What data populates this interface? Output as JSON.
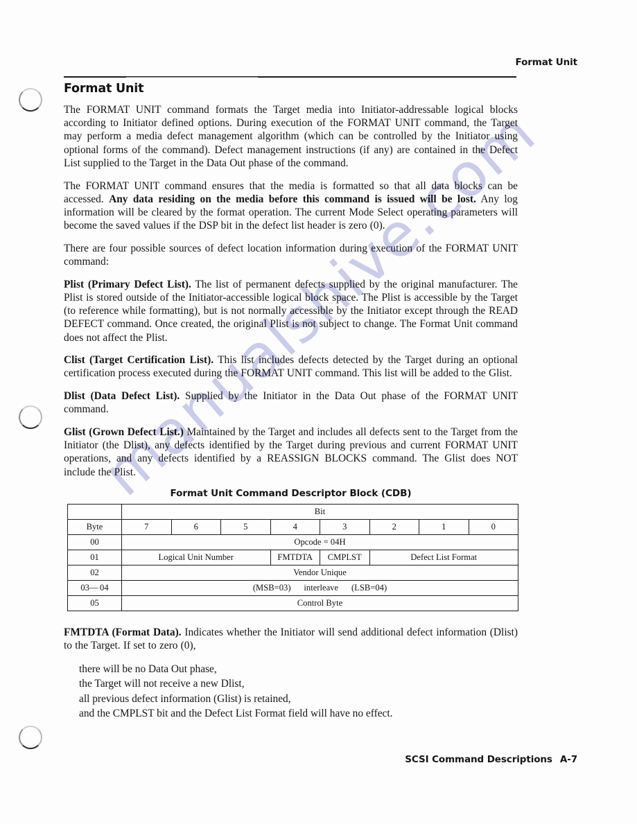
{
  "document": {
    "running_head": "Format Unit",
    "section_title": "Format Unit",
    "watermark": "manualshive.com",
    "watermark_color": "#c6c8ea",
    "footer": {
      "title": "SCSI Command Descriptions",
      "page": "A-7"
    },
    "ring_holes": 3
  },
  "paragraphs": {
    "p1": "The FORMAT UNIT command formats the Target media into Initiator-addressable logical blocks according to Initiator defined options. During execution of the FORMAT UNIT command, the Target may perform a media defect management algorithm (which can be controlled by the Initiator using optional forms of the command). Defect management instructions (if any) are contained in the Defect List supplied to the Target in the Data Out phase of the command.",
    "p2_a": "The FORMAT UNIT command ensures that the media is formatted so that all data blocks can be accessed. ",
    "p2_bold": "Any data residing on the media before this command is issued will be lost.",
    "p2_b": " Any log information will be cleared by the format operation. The current Mode Select operating parameters will become the saved values if the DSP bit in the defect list header is zero (0).",
    "p3": "There are four possible sources of defect location information during execution of the FORMAT UNIT command:",
    "plist_bold": "Plist (Primary Defect List).",
    "plist_text": " The list of permanent defects supplied by the original manufacturer. The Plist is stored outside of the Initiator-accessible logical block space. The Plist is accessible by the Target (to reference while formatting), but is not normally accessible by the Initiator except through the READ DEFECT command. Once created, the original Plist is not subject to change. The Format Unit command does not affect the Plist.",
    "clist_bold": "Clist (Target Certification List).",
    "clist_text": " This list includes defects detected by the Target during an optional certification process executed during the FORMAT UNIT command. This list will be added to the Glist.",
    "dlist_bold": "Dlist (Data Defect List).",
    "dlist_text": " Supplied by the Initiator in the Data Out phase of the FORMAT UNIT command.",
    "glist_bold": "Glist (Grown Defect List.)",
    "glist_text": " Maintained by the Target and includes all defects sent to the Target from the Initiator (the Dlist), any defects identified by the Target during previous and current FORMAT UNIT operations, and any defects identified by a REASSIGN BLOCKS command. The Glist does NOT include the Plist.",
    "fmtdta_bold": "FMTDTA (Format Data).",
    "fmtdta_text": " Indicates whether the Initiator will send additional defect information (Dlist) to the Target. If set to zero (0),"
  },
  "sublist": [
    "there will be no Data Out phase,",
    "the Target will not receive a new Dlist,",
    "all previous defect information (Glist) is retained,",
    "and the CMPLST bit and the Defect List Format field will have no effect."
  ],
  "table": {
    "caption": "Format Unit Command Descriptor Block (CDB)",
    "bit_header": "Bit",
    "byte_header": "Byte",
    "bit_numbers": [
      "7",
      "6",
      "5",
      "4",
      "3",
      "2",
      "1",
      "0"
    ],
    "rows": [
      {
        "byte": "00",
        "cells": [
          {
            "label": "Opcode = 04H",
            "span": 8
          }
        ]
      },
      {
        "byte": "01",
        "cells": [
          {
            "label": "Logical Unit Number",
            "span": 3
          },
          {
            "label": "FMTDTA",
            "span": 1
          },
          {
            "label": "CMPLST",
            "span": 1
          },
          {
            "label": "Defect List Format",
            "span": 3
          }
        ]
      },
      {
        "byte": "02",
        "cells": [
          {
            "label": "Vendor Unique",
            "span": 8
          }
        ]
      },
      {
        "byte": "03— 04",
        "cells": [
          {
            "label": "(MSB=03)  interleave  (LSB=04)",
            "span": 8
          }
        ]
      },
      {
        "byte": "05",
        "cells": [
          {
            "label": "Control Byte",
            "span": 8
          }
        ]
      }
    ]
  }
}
